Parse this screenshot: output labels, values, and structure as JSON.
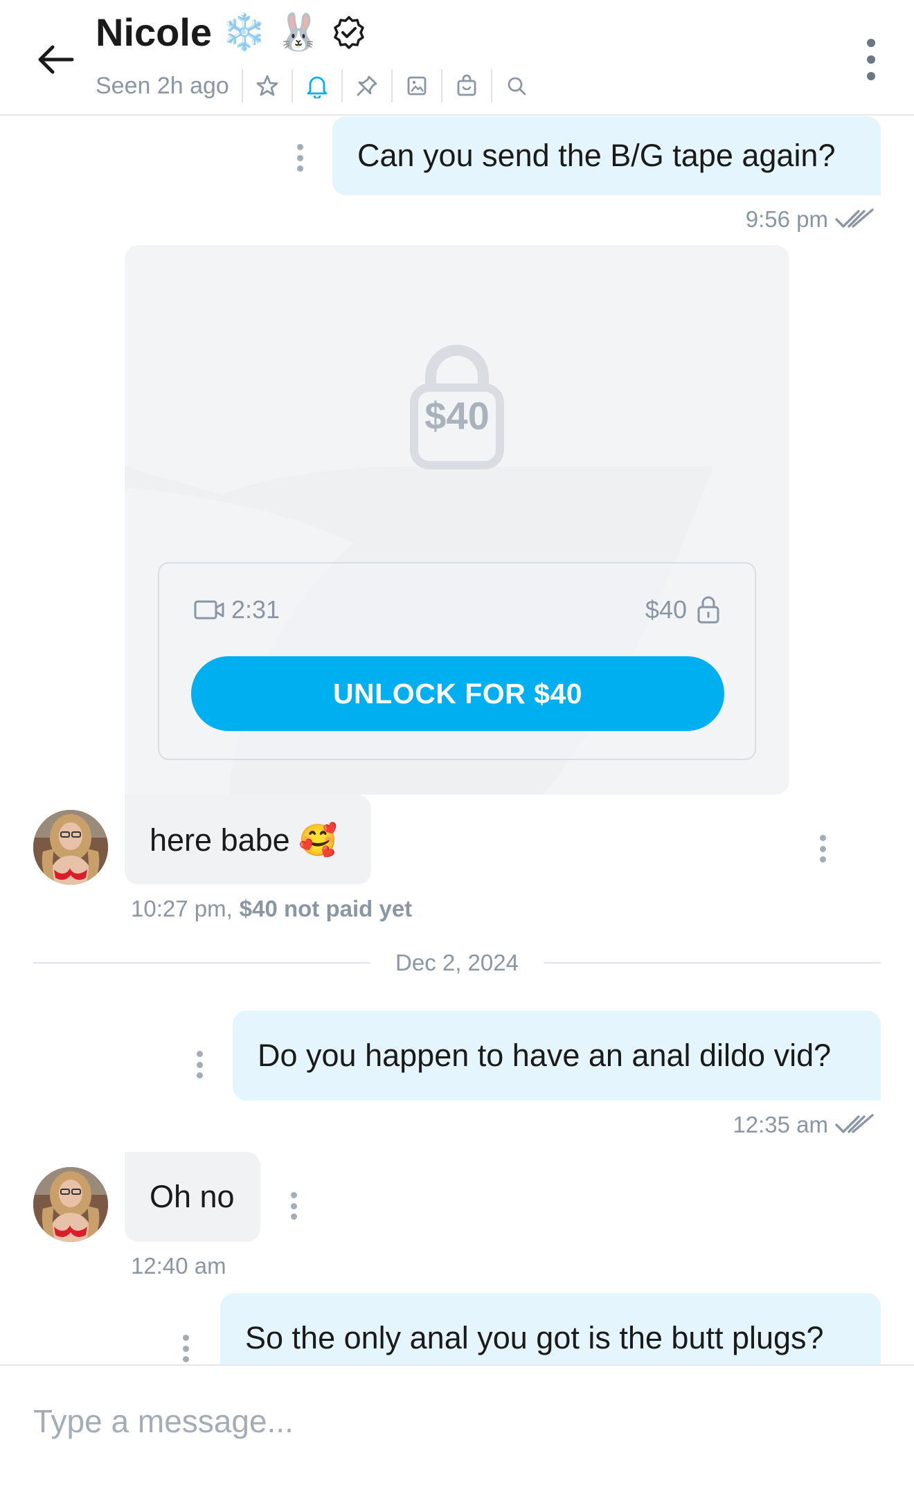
{
  "header": {
    "name": "Nicole",
    "emojis": [
      "❄️",
      "🐰"
    ],
    "seen": "Seen 2h ago",
    "icons": [
      "star-icon",
      "bell-icon",
      "pin-icon",
      "gallery-icon",
      "tip-bag-icon",
      "search-icon"
    ],
    "active_icon": "bell-icon"
  },
  "colors": {
    "accent": "#00aff0",
    "outgoing_bubble": "#e5f5fd",
    "incoming_bubble": "#f1f2f4",
    "muted_text": "#8a96a3"
  },
  "messages": [
    {
      "direction": "outgoing",
      "text": "Can you send the B/G tape again?",
      "time": "9:56 pm",
      "status": "read"
    },
    {
      "direction": "incoming",
      "media": {
        "locked": true,
        "price": "$40",
        "duration": "2:31",
        "unlock_label": "UNLOCK FOR $40"
      },
      "text": "here babe 🥰",
      "time": "10:27 pm,",
      "payment_status": "$40 not paid yet"
    },
    {
      "separator": "Dec 2, 2024"
    },
    {
      "direction": "outgoing",
      "text": "Do you happen to have an anal dildo vid?",
      "time": "12:35 am",
      "status": "read"
    },
    {
      "direction": "incoming",
      "text": "Oh no",
      "time": "12:40 am"
    },
    {
      "direction": "outgoing",
      "text": "So the only anal you got is the butt plugs?"
    }
  ],
  "composer": {
    "placeholder": "Type a message..."
  }
}
